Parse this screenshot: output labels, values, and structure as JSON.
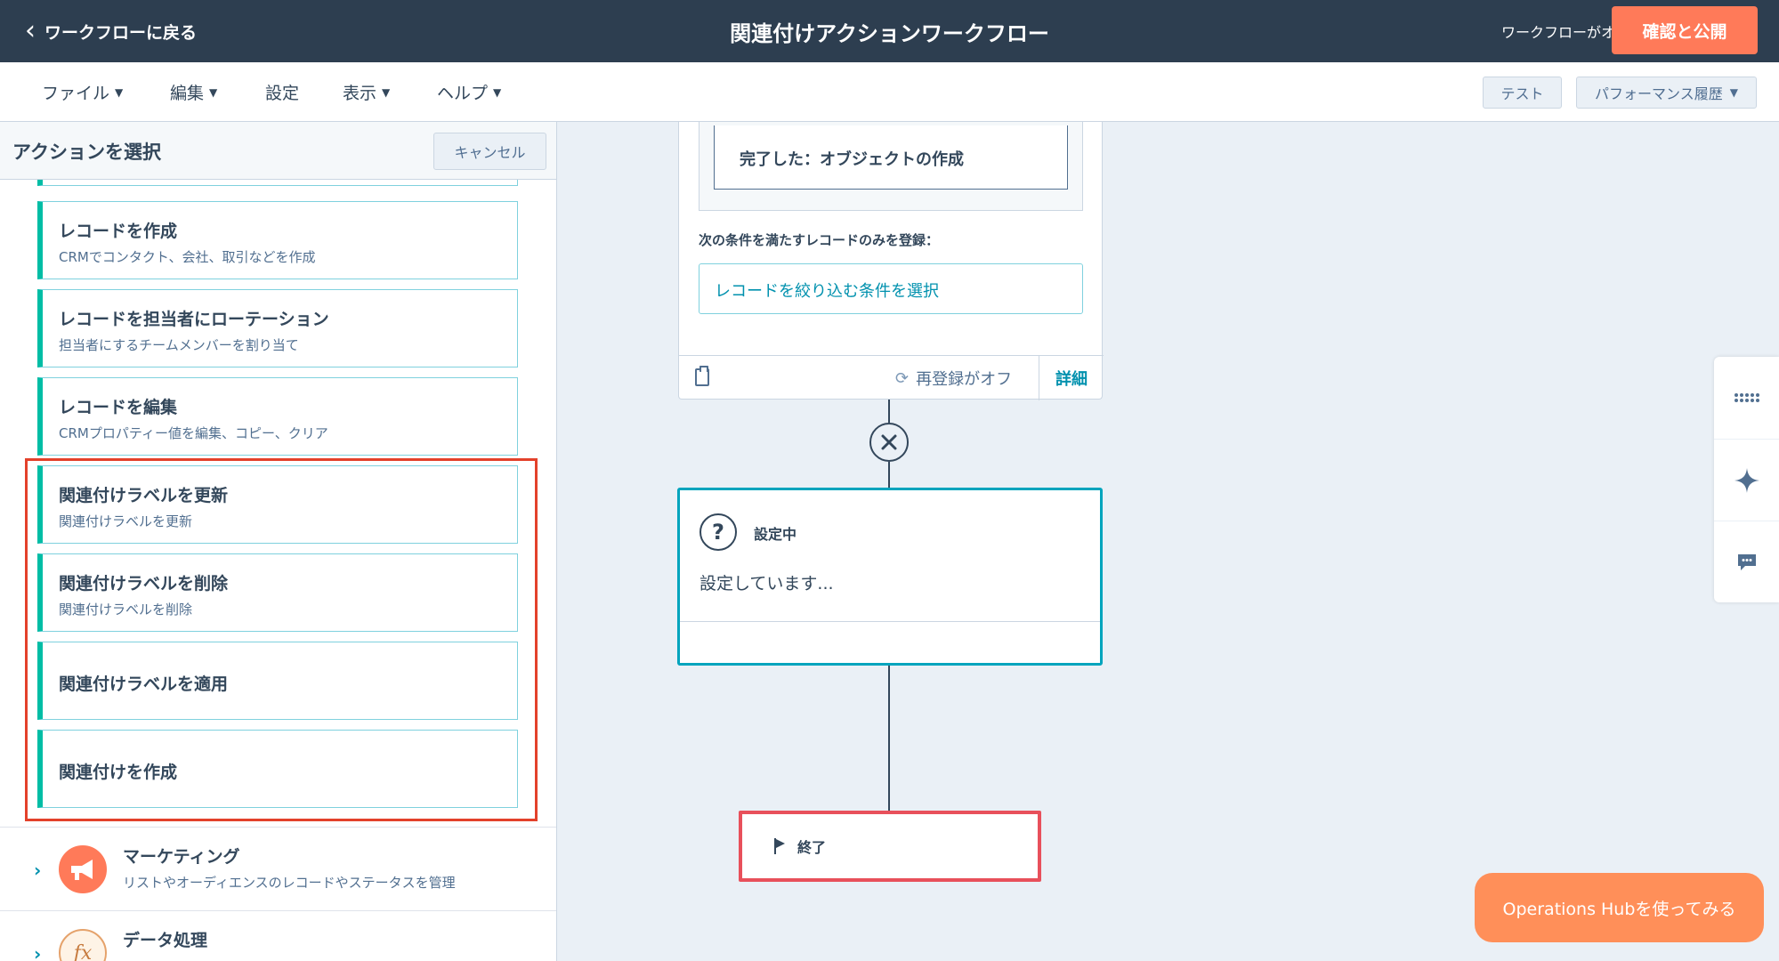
{
  "topbar": {
    "back_label": "ワークフローに戻る",
    "title": "関連付けアクションワークフロー",
    "status": "ワークフローがオフ",
    "publish_label": "確認と公開"
  },
  "menu": {
    "items": [
      "ファイル",
      "編集",
      "設定",
      "表示",
      "ヘルプ"
    ],
    "test_label": "テスト",
    "perf_label": "パフォーマンス履歴"
  },
  "panel": {
    "title": "アクションを選択",
    "cancel_label": "キャンセル",
    "cards": [
      {
        "title": "レコードを作成",
        "desc": "CRMでコンタクト、会社、取引などを作成"
      },
      {
        "title": "レコードを担当者にローテーション",
        "desc": "担当者にするチームメンバーを割り当て"
      },
      {
        "title": "レコードを編集",
        "desc": "CRMプロパティー値を編集、コピー、クリア"
      },
      {
        "title": "関連付けラベルを更新",
        "desc": "関連付けラベルを更新"
      },
      {
        "title": "関連付けラベルを削除",
        "desc": "関連付けラベルを削除"
      },
      {
        "title": "関連付けラベルを適用",
        "desc": ""
      },
      {
        "title": "関連付けを作成",
        "desc": ""
      }
    ],
    "categories": [
      {
        "title": "マーケティング",
        "desc": "リストやオーディエンスのレコードやステータスを管理"
      },
      {
        "title": "データ処理",
        "desc": ""
      }
    ]
  },
  "canvas": {
    "trigger": {
      "inner_text": "完了した：オブジェクトの作成",
      "condition_label": "次の条件を満たすレコードのみを登録：",
      "condition_placeholder": "レコードを絞り込む条件を選択",
      "reenroll": "再登録がオフ",
      "details": "詳細"
    },
    "action": {
      "title": "設定中",
      "body": "設定しています..."
    },
    "end": {
      "label": "終了"
    }
  },
  "ops_button": "Operations Hubを使ってみる",
  "colors": {
    "accent": "#ff7a59",
    "teal": "#00bda5",
    "link": "#0091ae",
    "highlight": "#e3412b",
    "dark": "#2d3e50"
  }
}
